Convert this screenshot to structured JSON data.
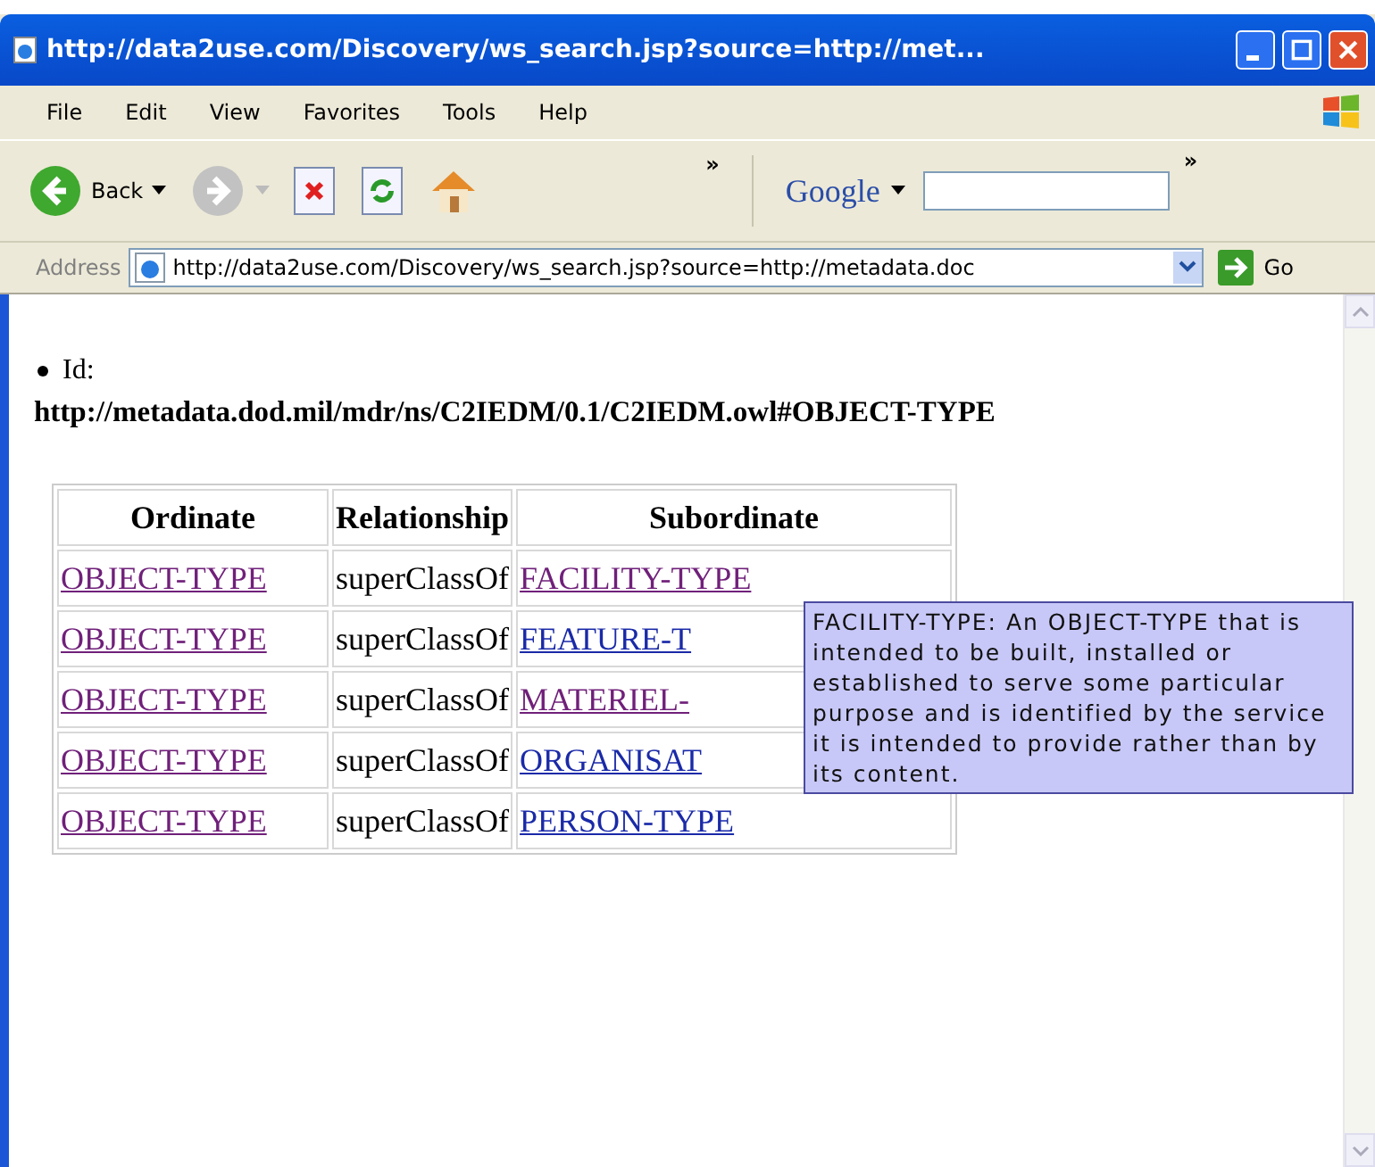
{
  "window": {
    "title": "http://data2use.com/Discovery/ws_search.jsp?source=http://met..."
  },
  "menu": [
    {
      "label": "File"
    },
    {
      "label": "Edit"
    },
    {
      "label": "View"
    },
    {
      "label": "Favorites"
    },
    {
      "label": "Tools"
    },
    {
      "label": "Help"
    }
  ],
  "toolbar": {
    "back_label": "Back",
    "chevron": "»",
    "search_label": "Google",
    "search_chevron": "»"
  },
  "address_bar": {
    "label": "Address",
    "value": "http://data2use.com/Discovery/ws_search.jsp?source=http://metadata.doc",
    "go_label": "Go"
  },
  "content": {
    "bullet_label": "Id:",
    "id": "http://metadata.dod.mil/mdr/ns/C2IEDM/0.1/C2IEDM.owl#OBJECT-TYPE",
    "table": {
      "columns": [
        "Ordinate",
        "Relationship",
        "Subordinate"
      ],
      "rows": [
        {
          "ordinate": {
            "text": "OBJECT-TYPE",
            "visited": true
          },
          "relationship": "superClassOf",
          "subordinate": {
            "text": "FACILITY-TYPE",
            "visited": true
          }
        },
        {
          "ordinate": {
            "text": "OBJECT-TYPE",
            "visited": true
          },
          "relationship": "superClassOf",
          "subordinate": {
            "text": "FEATURE-T",
            "visited": false
          }
        },
        {
          "ordinate": {
            "text": "OBJECT-TYPE",
            "visited": true
          },
          "relationship": "superClassOf",
          "subordinate": {
            "text": "MATERIEL-",
            "visited": true
          }
        },
        {
          "ordinate": {
            "text": "OBJECT-TYPE",
            "visited": true
          },
          "relationship": "superClassOf",
          "subordinate": {
            "text": "ORGANISAT",
            "visited": false
          }
        },
        {
          "ordinate": {
            "text": "OBJECT-TYPE",
            "visited": true
          },
          "relationship": "superClassOf",
          "subordinate": {
            "text": "PERSON-TYPE",
            "visited": false
          }
        }
      ]
    },
    "tooltip": "FACILITY-TYPE: An OBJECT-TYPE that is intended to be built, installed or established to serve some particular purpose and is identified by the service it is intended to provide rather than by its content."
  }
}
